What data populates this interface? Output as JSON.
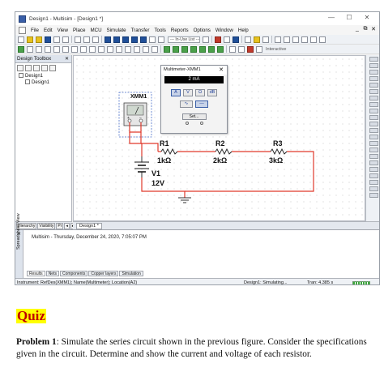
{
  "window": {
    "title": "Design1 - Multisim - [Design1 *]",
    "min_glyph": "—",
    "max_glyph": "☐",
    "close_glyph": "✕"
  },
  "menu": {
    "items": [
      "File",
      "Edit",
      "View",
      "Place",
      "MCU",
      "Simulate",
      "Transfer",
      "Tools",
      "Reports",
      "Options",
      "Window",
      "Help"
    ],
    "doc_controls": [
      "_",
      "⧉",
      "✕"
    ]
  },
  "toolbar": {
    "in_use_list": "--- In-Use List ---",
    "interactive_label": "Interactive"
  },
  "design_toolbox": {
    "title": "Design Toolbox",
    "close_glyph": "✕",
    "tree": [
      {
        "label": "Design1",
        "indent": 1
      },
      {
        "label": "Design1",
        "indent": 2
      }
    ],
    "tabs": [
      "Hierarchy",
      "Visibility",
      "Pr",
      "◂",
      "▸"
    ]
  },
  "document_tab": {
    "label": "Design1 *"
  },
  "multimeter_window": {
    "title": "Multimeter-XMM1",
    "close_glyph": "✕",
    "display": "2 mA",
    "modes": [
      "A",
      "V",
      "Ω",
      "dB"
    ],
    "wave_buttons": [
      "∿",
      "—"
    ],
    "set_label": "Set...",
    "terminals": [
      "+",
      "−"
    ]
  },
  "schematic": {
    "meter_label": "XMM1",
    "meter_terminals": [
      "+",
      "−"
    ],
    "resistors": [
      {
        "ref": "R1",
        "value": "1kΩ"
      },
      {
        "ref": "R2",
        "value": "2kΩ"
      },
      {
        "ref": "R3",
        "value": "3kΩ"
      }
    ],
    "source": {
      "ref": "V1",
      "value": "12V"
    },
    "wire_color": "#e0392b",
    "component_color": "#1a1a1a"
  },
  "spreadsheet": {
    "side_label": "Spreadsheet View",
    "close_glyph": "✕",
    "log_line": "Multisim  -  Thursday, December 24, 2020, 7:05:07 PM",
    "tabs": [
      "Results",
      "Nets",
      "Components",
      "Copper layers",
      "Simulation"
    ]
  },
  "status": {
    "instrument": "Instrument: RefDes(XMM1); Name(Multimeter); Location(A2)",
    "sim_state": "Design1: Simulating...",
    "tran": "Tran: 4.385 s"
  },
  "quiz": {
    "title": "Quiz",
    "problem_label": "Problem 1",
    "problem_text": ": Simulate the series circuit shown in the previous figure. Consider the specifications given in the circuit. Determine and show the current and voltage of each resistor."
  }
}
